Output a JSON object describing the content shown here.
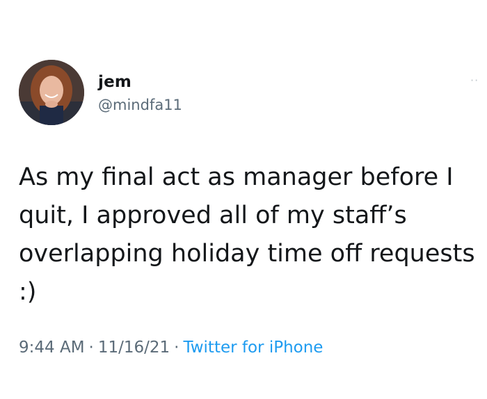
{
  "tweet": {
    "user": {
      "display_name": "jem",
      "handle": "@mindfa11"
    },
    "text": "As my final act as manager before I quit, I approved all of my staff’s overlapping holiday time off requests :)",
    "time": "9:44 AM",
    "date": "11/16/21",
    "separator": "·",
    "source": "Twitter for iPhone",
    "more_icon": "more-dots-icon"
  },
  "colors": {
    "text": "#14171a",
    "secondary": "#5b6b78",
    "link": "#1d9bf0",
    "background": "#ffffff"
  }
}
